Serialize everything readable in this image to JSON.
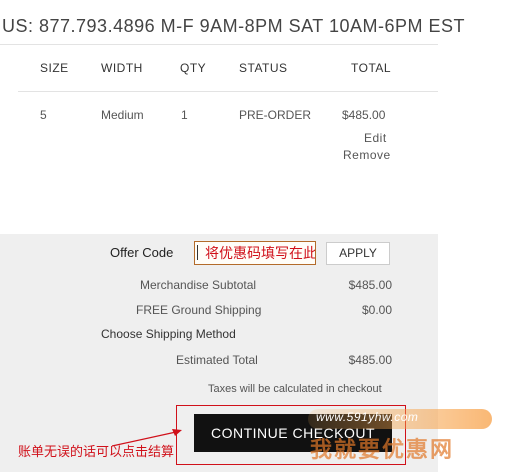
{
  "header": {
    "phone_line": "US: 877.793.4896 M-F 9AM-8PM SAT 10AM-6PM EST"
  },
  "table": {
    "columns": [
      "SIZE",
      "WIDTH",
      "QTY",
      "STATUS",
      "TOTAL"
    ],
    "row": {
      "size": "5",
      "width": "Medium",
      "qty": "1",
      "status": "PRE-ORDER",
      "total": "$485.00",
      "edit_label": "Edit",
      "remove_label": "Remove"
    }
  },
  "summary": {
    "offer_code_label": "Offer Code",
    "offer_code_value": "将优惠码填写在此处",
    "apply_label": "APPLY",
    "merch_subtotal_label": "Merchandise Subtotal",
    "merch_subtotal_value": "$485.00",
    "shipping_label": "FREE Ground Shipping",
    "shipping_value": "$0.00",
    "choose_shipping_label": "Choose Shipping Method",
    "estimated_total_label": "Estimated Total",
    "estimated_total_value": "$485.00",
    "taxes_note": "Taxes will be calculated in checkout",
    "checkout_label": "CONTINUE CHECKOUT"
  },
  "annotation": {
    "text": "账单无误的话可以点击结算"
  },
  "watermark": {
    "url": "www.591yhw.com",
    "name": "我就要优惠网"
  },
  "colors": {
    "accent_red": "#d0101a",
    "button_black": "#111111",
    "summary_bg": "#efefef"
  }
}
